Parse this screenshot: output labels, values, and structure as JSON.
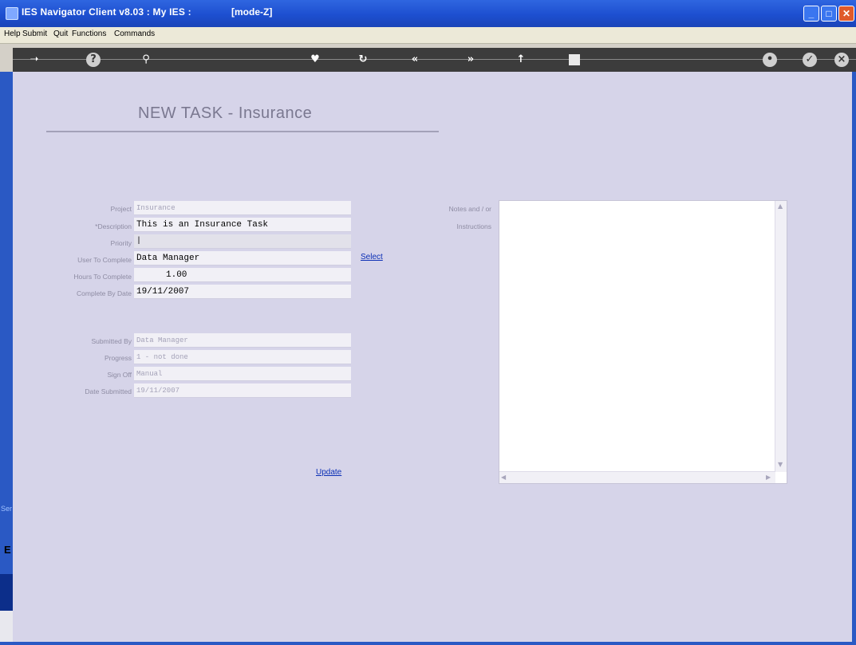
{
  "window": {
    "title": "IES Navigator Client v8.03 : My IES :",
    "mode": "[mode-Z]"
  },
  "menu": [
    "Help",
    "Submit",
    "Quit",
    "Functions",
    "Commands"
  ],
  "page": {
    "title": "NEW TASK - Insurance"
  },
  "form": {
    "project": {
      "label": "Project",
      "value": "Insurance"
    },
    "description": {
      "label": "*Description",
      "value": "This is an Insurance Task"
    },
    "priority": {
      "label": "Priority",
      "value": "|"
    },
    "user_to_complete": {
      "label": "User To Complete",
      "value": "Data Manager"
    },
    "hours_to_complete": {
      "label": "Hours To Complete",
      "value": "1.00"
    },
    "complete_by_date": {
      "label": "Complete By Date",
      "value": "19/11/2007"
    },
    "submitted_by": {
      "label": "Submitted By",
      "value": "Data Manager"
    },
    "progress": {
      "label": "Progress",
      "value": "1 - not done"
    },
    "sign_off": {
      "label": "Sign Off",
      "value": "Manual"
    },
    "date_submitted": {
      "label": "Date Submitted",
      "value": "19/11/2007"
    },
    "select_label": "Select",
    "update_label": "Update"
  },
  "notes": {
    "label_line1": "Notes and / or",
    "label_line2": "Instructions"
  },
  "sidebar": {
    "tab_text": "Ser",
    "tab_letter": "E"
  }
}
